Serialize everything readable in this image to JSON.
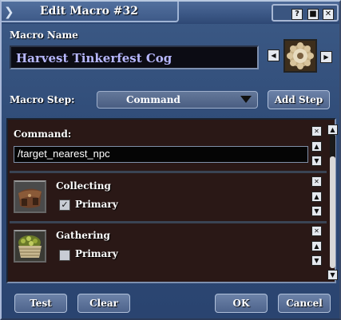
{
  "window": {
    "title": "Edit Macro #32",
    "help_icon": "?",
    "minimize_icon": "■",
    "close_icon": "✕"
  },
  "macro_name": {
    "label": "Macro Name",
    "value": "Harvest Tinkerfest Cog"
  },
  "macro_step": {
    "label": "Macro Step:",
    "selected": "Command",
    "add_label": "Add Step"
  },
  "steps": [
    {
      "type": "command",
      "label": "Command:",
      "value": "/target_nearest_npc"
    },
    {
      "type": "ability",
      "name": "Collecting",
      "checkbox_label": "Primary",
      "checked": true
    },
    {
      "type": "ability",
      "name": "Gathering",
      "checkbox_label": "Primary",
      "checked": false
    }
  ],
  "footer": {
    "test": "Test",
    "clear": "Clear",
    "ok": "OK",
    "cancel": "Cancel"
  }
}
